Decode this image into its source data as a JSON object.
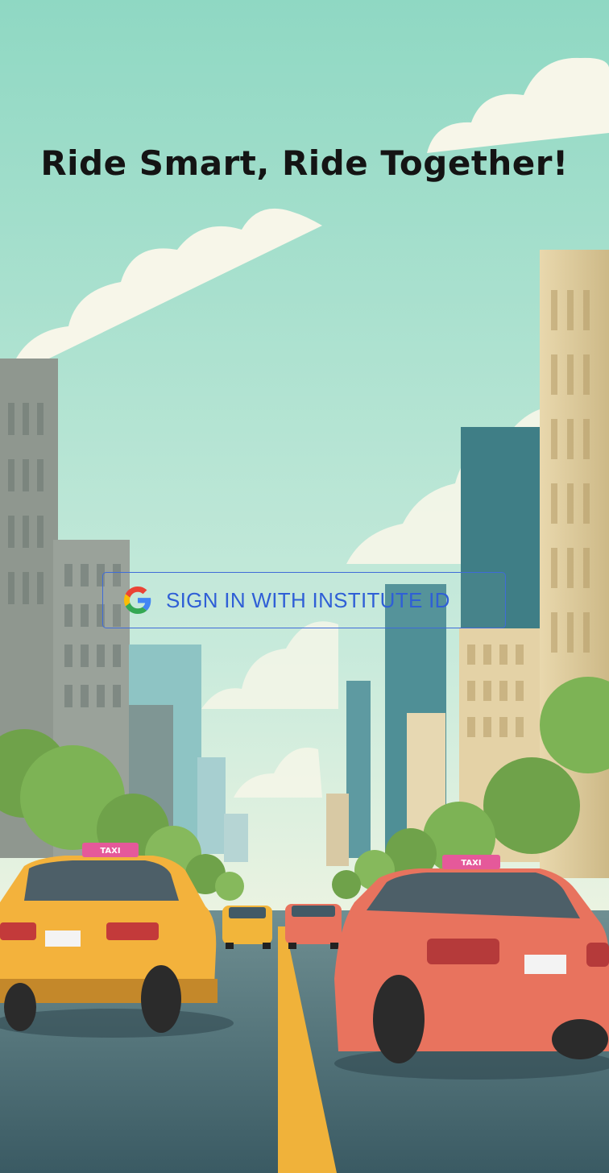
{
  "headline": "Ride Smart, Ride Together!",
  "signin": {
    "label": "SIGN IN WITH INSTITUTE ID",
    "icon": "google-g-icon"
  },
  "colors": {
    "sky": "#a9e2cf",
    "road": "#3e6168",
    "center_line": "#f0b23a",
    "button_border": "#3f6bd8",
    "button_text": "#2f5fd6",
    "taxi_yellow": "#f3b23c",
    "taxi_red": "#e8735e"
  },
  "taxis": {
    "left_sign": "TAXI",
    "right_sign": "TAXI"
  }
}
